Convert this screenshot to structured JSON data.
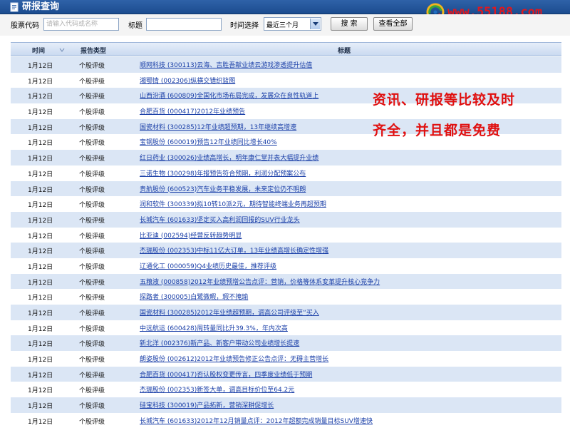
{
  "header": {
    "title": "研报查询",
    "logo_text": "www.55188.com"
  },
  "search": {
    "stock_code_label": "股票代码",
    "stock_code_placeholder": "请输入代码或名称",
    "title_label": "标题",
    "title_value": "",
    "time_label": "时间选择",
    "time_value": "最近三个月",
    "search_button": "搜 索",
    "view_all_button": "查看全部"
  },
  "table": {
    "columns": [
      "时间",
      "报告类型",
      "标题"
    ],
    "rows": [
      {
        "date": "1月12日",
        "type": "个股评级",
        "title": "顺网科技 (300113)云海、吉胜吾献业绩云游戏渗透提升估值"
      },
      {
        "date": "1月12日",
        "type": "个股评级",
        "title": "湘鄂情 (002306)纵横交错织篮图"
      },
      {
        "date": "1月12日",
        "type": "个股评级",
        "title": "山西汾酒 (600809)全国化市场布局完成，发展众在良性轨道上"
      },
      {
        "date": "1月12日",
        "type": "个股评级",
        "title": "合肥百货 (000417)2012年业绩预告"
      },
      {
        "date": "1月12日",
        "type": "个股评级",
        "title": "国瓷材料 (300285)12年业绩超预期，13年继续高增速"
      },
      {
        "date": "1月12日",
        "type": "个股评级",
        "title": "宝钢股份 (600019)预告12年业绩同比增长40%"
      },
      {
        "date": "1月12日",
        "type": "个股评级",
        "title": "红日药业 (300026)业绩高增长，明年康仁堂并表大幅提升业绩"
      },
      {
        "date": "1月12日",
        "type": "个股评级",
        "title": "三诺生物 (300298)年报预告符合预期，利润分配预案公布"
      },
      {
        "date": "1月12日",
        "type": "个股评级",
        "title": "贵航股份 (600523)汽车业务平稳发展，未来定位仍不明朗"
      },
      {
        "date": "1月12日",
        "type": "个股评级",
        "title": "润和软件 (300339)拟10转10派2元，期待智能终端业务再超预期"
      },
      {
        "date": "1月12日",
        "type": "个股评级",
        "title": "长城汽车 (601633)坚定买入高利润回报的SUV行业龙头"
      },
      {
        "date": "1月12日",
        "type": "个股评级",
        "title": "比亚迪 (002594)经营反转趋势明显"
      },
      {
        "date": "1月12日",
        "type": "个股评级",
        "title": "杰瑞股份 (002353)中标11亿大订单，13年业绩高增长确定性增强"
      },
      {
        "date": "1月12日",
        "type": "个股评级",
        "title": "辽通化工 (000059)Q4业绩历史最佳，推荐评级"
      },
      {
        "date": "1月12日",
        "type": "个股评级",
        "title": "五粮液 (000858)2012年业绩预增公告点评：营销，价格等体系变革提升核心竞争力"
      },
      {
        "date": "1月12日",
        "type": "个股评级",
        "title": "探路者 (300005)白鹭微暇，瑕不掩瑜"
      },
      {
        "date": "1月12日",
        "type": "个股评级",
        "title": "国瓷材料 (300285)2012年业绩超预期，调高公司评级至“买入"
      },
      {
        "date": "1月12日",
        "type": "个股评级",
        "title": "中远航运 (600428)周转量同比升39.3%，年内次高"
      },
      {
        "date": "1月12日",
        "type": "个股评级",
        "title": "新北洋 (002376)新产品、新客户带动公司业绩增长提速"
      },
      {
        "date": "1月12日",
        "type": "个股评级",
        "title": "朗姿股份 (002612)2012年业绩预告修正公告点评：无碍主营增长"
      },
      {
        "date": "1月12日",
        "type": "个股评级",
        "title": "合肥百货 (000417)否认股权变更传言，四季度业绩低于预期"
      },
      {
        "date": "1月12日",
        "type": "个股评级",
        "title": "杰瑞股份 (002353)新签大单，调高目标价位至64.2元"
      },
      {
        "date": "1月12日",
        "type": "个股评级",
        "title": "硅宝科技 (300019)产品拓新，营销深耕促增长"
      },
      {
        "date": "1月12日",
        "type": "个股评级",
        "title": "长城汽车 (601633)2012年12月销量点评：2012年超额完成销量目标SUV增速快"
      }
    ]
  },
  "overlay": {
    "line1": "资讯、研报等比较及时",
    "line2": "齐全，并且都是免费"
  },
  "colors": {
    "titlebar": "#1b4c8f",
    "row_stripe": "#dbe6f5",
    "link": "#1a3fa8",
    "note": "#e01010",
    "logo": "#e0181e"
  }
}
